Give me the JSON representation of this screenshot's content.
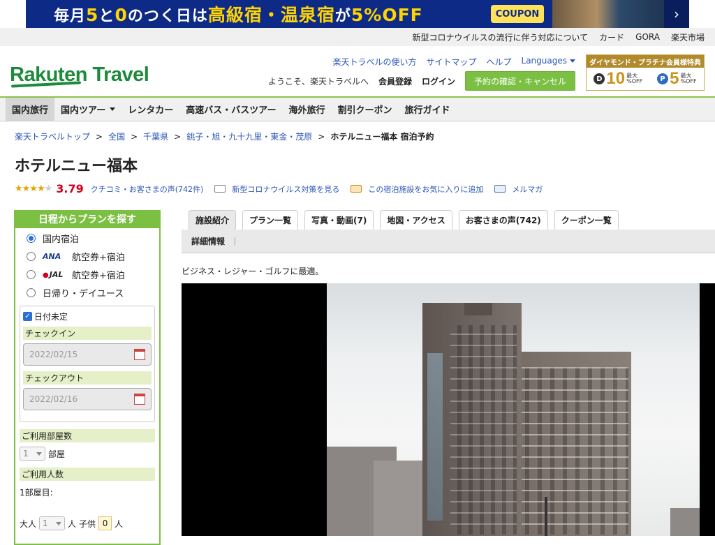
{
  "banner": {
    "text_a": "毎月",
    "text_b": "5",
    "text_c": "と",
    "text_d": "0",
    "text_e": "のつく日は",
    "text_f": "高級宿・温泉宿",
    "text_g": "が",
    "text_h": "5%OFF",
    "coupon": "COUPON",
    "next_icon": "chevron-right-icon"
  },
  "utilbar": {
    "items": [
      "新型コロナウイルスの流行に伴う対応について",
      "カード",
      "GORA",
      "楽天市場"
    ]
  },
  "header": {
    "logo": "Rakuten Travel",
    "nav1": [
      "楽天トラベルの使い方",
      "サイトマップ",
      "ヘルプ",
      "Languages"
    ],
    "welcome": "ようこそ、楽天トラベルへ",
    "register": "会員登録",
    "login": "ログイン",
    "reservation_button": "予約の確認・キャンセル",
    "promo": {
      "title": "ダイヤモンド・プラチナ会員様特典",
      "d_label": "D",
      "d_num": "10",
      "p_label": "P",
      "p_num": "5",
      "max": "最大",
      "off": "%OFF"
    }
  },
  "mainnav": {
    "items": [
      "国内旅行",
      "国内ツアー",
      "レンタカー",
      "高速バス・バスツアー",
      "海外旅行",
      "割引クーポン",
      "旅行ガイド"
    ]
  },
  "breadcrumb": {
    "items": [
      "楽天トラベルトップ",
      "全国",
      "千葉県",
      "銚子・旭・九十九里・東金・茂原"
    ],
    "current": "ホテルニュー福本 宿泊予約",
    "sep": ">"
  },
  "hotel": {
    "name": "ホテルニュー福本",
    "stars_full": "★★★★",
    "stars_empty": "★",
    "score": "3.79",
    "reviews_link": "クチコミ・お客さまの声(742件)",
    "covid_link": "新型コロナウイルス対策を見る",
    "favorite_link": "この宿泊施設をお気に入りに追加",
    "mail_link": "メルマガ",
    "description": "ビジネス・レジャー・ゴルフに最適。"
  },
  "search": {
    "title": "日程からプランを探す",
    "options": [
      {
        "airline": "",
        "label": "国内宿泊"
      },
      {
        "airline": "ANA",
        "label": "航空券+宿泊"
      },
      {
        "airline": "JAL",
        "label": "航空券+宿泊"
      },
      {
        "airline": "",
        "label": "日帰り・デイユース"
      }
    ],
    "date_undecided": "日付未定",
    "checkin_label": "チェックイン",
    "checkin_value": "2022/02/15",
    "checkout_label": "チェックアウト",
    "checkout_value": "2022/02/16",
    "rooms_label": "ご利用部屋数",
    "rooms_value": "1",
    "rooms_unit": "部屋",
    "people_label": "ご利用人数",
    "room1_label": "1部屋目:",
    "adult_label": "大人",
    "adult_value": "1",
    "person_unit": "人",
    "child_label": "子供",
    "child_value": "0",
    "child_unit": "人"
  },
  "tabs": {
    "items": [
      "施設紹介",
      "プラン一覧",
      "写真・動画(7)",
      "地図・アクセス",
      "お客さまの声(742)",
      "クーポン一覧"
    ],
    "active_index": 0,
    "sub": "詳細情報"
  }
}
